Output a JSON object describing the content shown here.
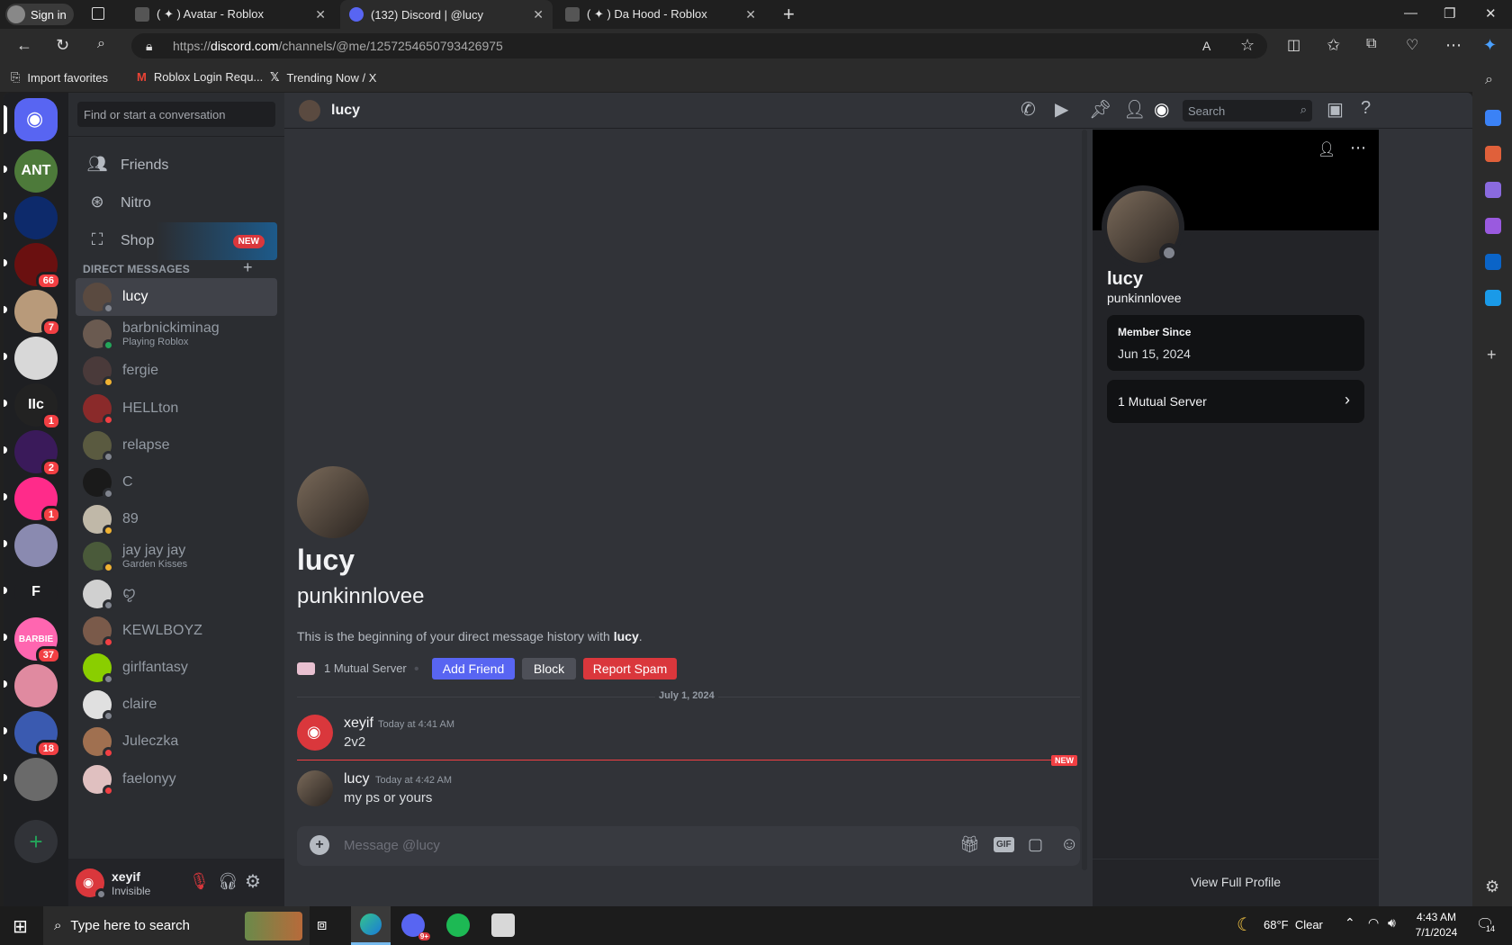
{
  "browser": {
    "signin_label": "Sign in",
    "tabs": [
      {
        "title": "( ✦ ) Avatar - Roblox"
      },
      {
        "title": "(132) Discord | @lucy",
        "badge": "132"
      },
      {
        "title": "( ✦ ) Da Hood - Roblox"
      }
    ],
    "url_prefix": "https://",
    "url_host": "discord.com",
    "url_path": "/channels/@me/1257254650793426975",
    "favorites": [
      "Import favorites",
      "Roblox Login Requ...",
      "Trending Now / X"
    ]
  },
  "guilds": [
    {
      "name": "home",
      "color": "#5865f2"
    },
    {
      "name": "ANT",
      "color": "#4d7a3a",
      "label": "ANT"
    },
    {
      "name": "star",
      "color": "#0d2a6b"
    },
    {
      "name": "red",
      "color": "#6a1010",
      "badge": "66"
    },
    {
      "name": "boy",
      "color": "#b89a7a",
      "badge": "7"
    },
    {
      "name": "dark",
      "color": "#d8d8d8"
    },
    {
      "name": "IIc",
      "color": "#222",
      "badge": "1",
      "label": "IIc"
    },
    {
      "name": "purple",
      "color": "#3a1a5a",
      "badge": "2"
    },
    {
      "name": "pink",
      "color": "#ff2b8a",
      "badge": "1"
    },
    {
      "name": "anime",
      "color": "#8a8ab0"
    },
    {
      "name": "F",
      "color": "#1e1f22",
      "label": "F"
    },
    {
      "name": "barbie",
      "color": "#ff66b0",
      "badge": "37",
      "label": "BARBIE"
    },
    {
      "name": "clouds",
      "color": "#e08aa0"
    },
    {
      "name": "blue",
      "color": "#3a5ab0",
      "badge": "18"
    },
    {
      "name": "photo",
      "color": "#6a6a6a"
    }
  ],
  "sidebar": {
    "search_placeholder": "Find or start a conversation",
    "nav": [
      {
        "label": "Friends"
      },
      {
        "label": "Nitro"
      },
      {
        "label": "Shop",
        "badge": "NEW"
      }
    ],
    "dm_header": "DIRECT MESSAGES",
    "dms": [
      {
        "name": "lucy",
        "status": "offline",
        "color": "#5a4a40"
      },
      {
        "name": "barbnickiminag",
        "sub": "Playing Roblox",
        "status": "online",
        "color": "#6a5a50"
      },
      {
        "name": "fergie",
        "status": "idle",
        "color": "#4a3a3a"
      },
      {
        "name": "HELLton",
        "status": "dnd",
        "color": "#8a2a2a"
      },
      {
        "name": "relapse",
        "status": "offline",
        "color": "#5a5a40"
      },
      {
        "name": "C",
        "status": "offline",
        "color": "#1a1a1a"
      },
      {
        "name": "89",
        "status": "idle",
        "color": "#c0b8a8"
      },
      {
        "name": "jay jay jay",
        "sub": "Garden Kisses",
        "status": "idle",
        "color": "#4a5a3a"
      },
      {
        "name": "ꨄ",
        "status": "offline",
        "color": "#d0d0d0"
      },
      {
        "name": "KEWLBOYZ",
        "status": "dnd",
        "color": "#7a5a4a"
      },
      {
        "name": "girlfantasy",
        "status": "offline",
        "color": "#8ace00"
      },
      {
        "name": "claire",
        "status": "offline",
        "color": "#e0e0e0"
      },
      {
        "name": "Juleczka",
        "status": "dnd",
        "color": "#a07050"
      },
      {
        "name": "faelonyy",
        "status": "dnd",
        "color": "#e0c0c0"
      }
    ],
    "user": {
      "name": "xeyif",
      "status": "Invisible"
    }
  },
  "channel": {
    "name": "lucy",
    "search_placeholder": "Search"
  },
  "chat": {
    "intro_name": "lucy",
    "intro_username": "punkinnlovee",
    "intro_text_pre": "This is the beginning of your direct message history with ",
    "intro_text_name": "lucy",
    "intro_text_post": ".",
    "mutual_label": "1 Mutual Server",
    "add_friend": "Add Friend",
    "block": "Block",
    "report_spam": "Report Spam",
    "date_divider": "July 1, 2024",
    "new_label": "NEW",
    "messages": [
      {
        "author": "xeyif",
        "time": "Today at 4:41 AM",
        "text": "2v2"
      },
      {
        "author": "lucy",
        "time": "Today at 4:42 AM",
        "text": "my ps or yours"
      }
    ],
    "input_placeholder": "Message @lucy"
  },
  "profile": {
    "display_name": "lucy",
    "username": "punkinnlovee",
    "member_since_label": "Member Since",
    "member_since": "Jun 15, 2024",
    "mutual_servers": "1 Mutual Server",
    "view_full": "View Full Profile"
  },
  "taskbar": {
    "search_placeholder": "Type here to search",
    "weather": "68°F  Clear",
    "time": "4:43 AM",
    "date": "7/1/2024",
    "notif_count": "14",
    "discord_badge": "9+"
  },
  "colors": {
    "blurple": "#5865f2",
    "red": "#da373c",
    "bg": "#313338"
  }
}
